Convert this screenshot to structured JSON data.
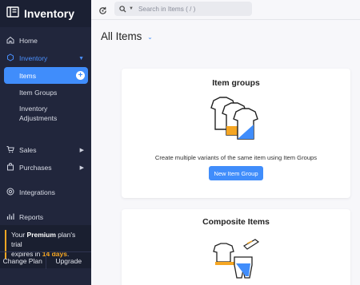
{
  "brand": {
    "title": "Inventory"
  },
  "sidebar": {
    "home": "Home",
    "inventory": "Inventory",
    "items": "Items",
    "item_groups": "Item Groups",
    "inventory_adjustments_line1": "Inventory",
    "inventory_adjustments_line2": "Adjustments",
    "sales": "Sales",
    "purchases": "Purchases",
    "integrations": "Integrations",
    "reports": "Reports"
  },
  "trial": {
    "prefix": "Your ",
    "plan": "Premium",
    "middle": " plan's trial",
    "line2_prefix": "expires in ",
    "days": "14 days",
    "suffix": ".",
    "change_plan": "Change Plan",
    "upgrade": "Upgrade"
  },
  "search": {
    "placeholder": "Search in Items ( / )"
  },
  "page": {
    "title": "All Items"
  },
  "cards": [
    {
      "title": "Item groups",
      "description": "Create multiple variants of the same item using Item Groups",
      "button": "New Item Group"
    },
    {
      "title": "Composite Items"
    }
  ],
  "colors": {
    "accent": "#408dfb",
    "sidebar": "#21263c",
    "highlight": "#f5a623"
  }
}
